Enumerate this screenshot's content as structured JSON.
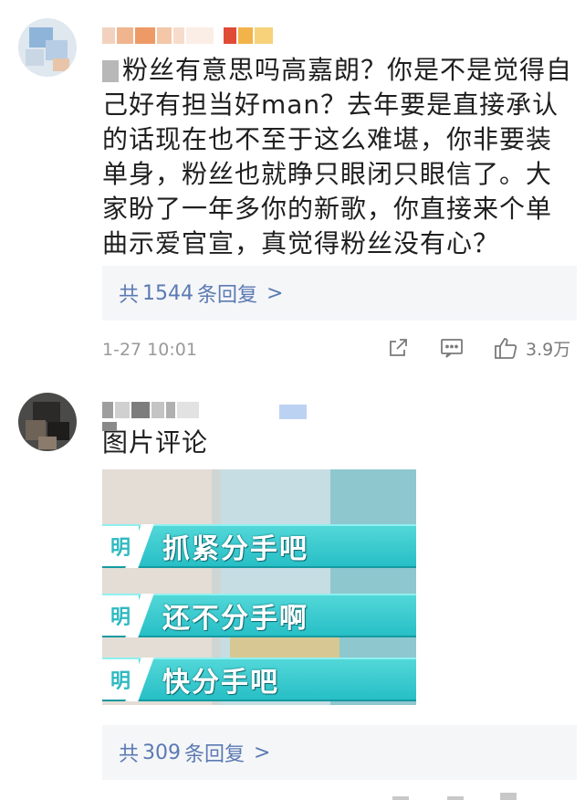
{
  "comments": [
    {
      "text": "粉丝有意思吗高嘉朗？你是不是觉得自己好有担当好man？去年要是直接承认的话现在也不至于这么难堪，你非要装单身，粉丝也就睁只眼闭只眼信了。大家盼了一年多你的新歌，你直接来个单曲示爱官宣，真觉得粉丝没有心？",
      "reply_prefix": "共",
      "reply_count": "1544",
      "reply_suffix": "条回复",
      "reply_chevron": ">",
      "timestamp": "1-27 10:01",
      "like_count": "3.9万",
      "icons": [
        "share-icon",
        "comment-icon",
        "like-icon"
      ]
    },
    {
      "text": "图片评论",
      "image_captions": [
        "抓紧分手吧",
        "还不分手啊",
        "快分手吧"
      ],
      "image_tag": "明",
      "reply_prefix": "共",
      "reply_count": "309",
      "reply_suffix": "条回复",
      "reply_chevron": ">"
    }
  ],
  "colors": {
    "link": "#5b7ab3",
    "meta": "#9a9a9a",
    "reply_bg": "#f5f6f8",
    "caption_bar": "#2fc5cc"
  }
}
